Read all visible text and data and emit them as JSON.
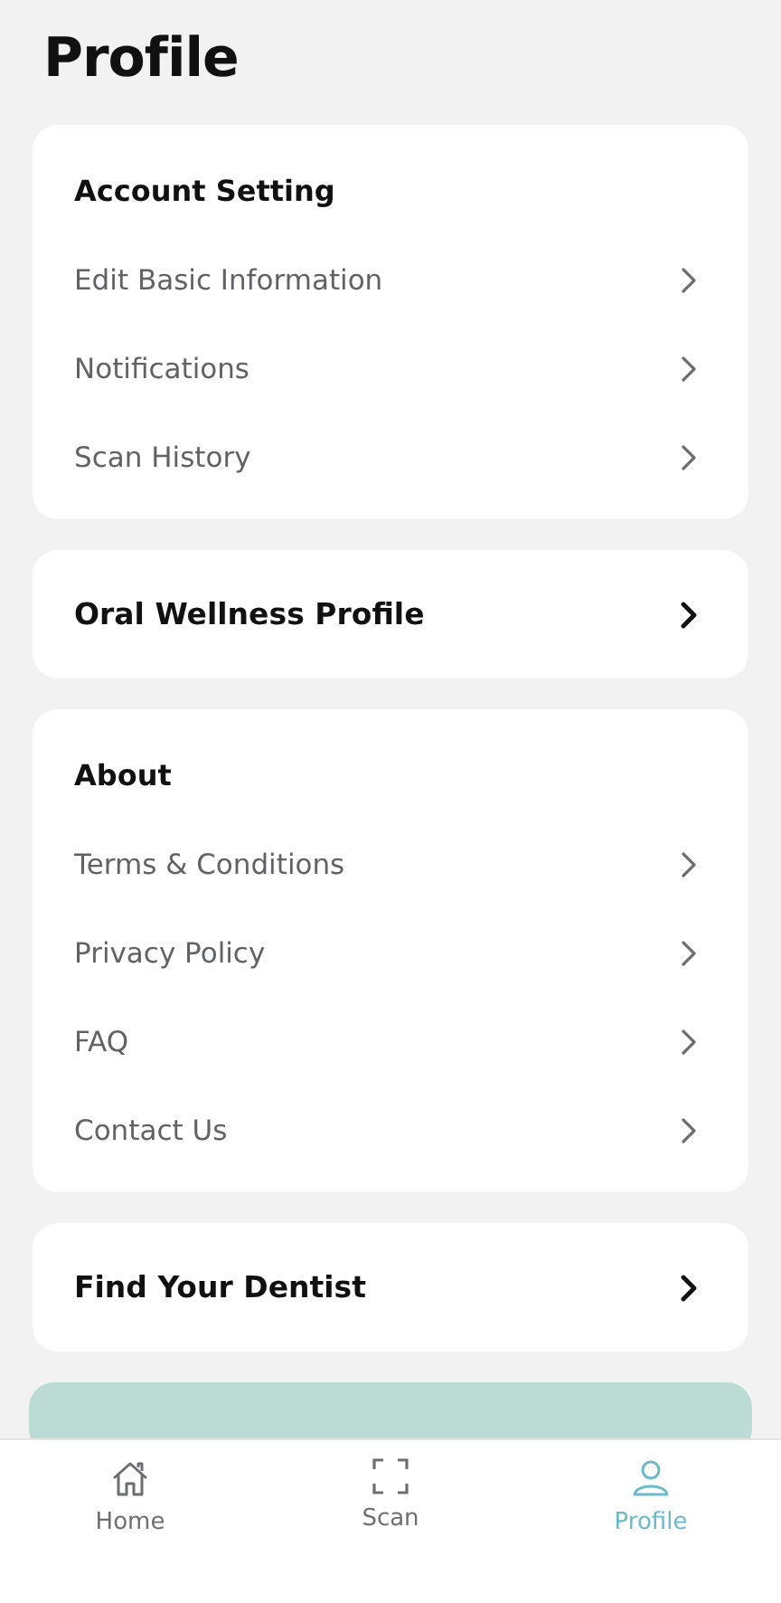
{
  "title": "Profile",
  "sections": [
    {
      "kind": "group",
      "title": "Account Setting",
      "items": [
        "Edit Basic Information",
        "Notifications",
        "Scan History"
      ]
    },
    {
      "kind": "link",
      "title": "Oral Wellness Profile"
    },
    {
      "kind": "group",
      "title": "About",
      "items": [
        "Terms & Conditions",
        "Privacy Policy",
        "FAQ",
        "Contact Us"
      ]
    },
    {
      "kind": "link",
      "title": "Find Your Dentist"
    }
  ],
  "nav": [
    {
      "label": "Home",
      "selected": false
    },
    {
      "label": "Scan",
      "selected": false
    },
    {
      "label": "Profile",
      "selected": true
    }
  ]
}
